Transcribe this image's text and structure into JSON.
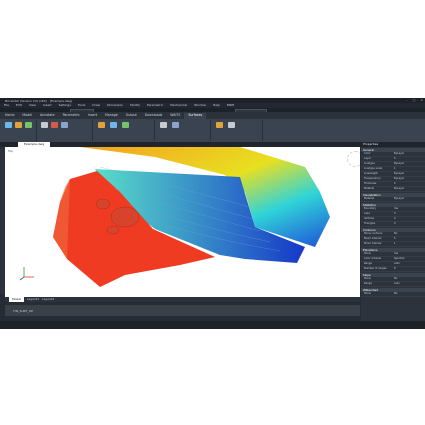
{
  "window": {
    "title": "BricsCAD (Version 24) (x64) - [Example.dwg]"
  },
  "menu": [
    "File",
    "Edit",
    "View",
    "Insert",
    "Settings",
    "Tools",
    "Draw",
    "Dimension",
    "Modify",
    "Parametric",
    "Mechanical",
    "Window",
    "Help",
    "MRM"
  ],
  "ribbon_tabs": [
    {
      "label": "Home",
      "active": false
    },
    {
      "label": "Model",
      "active": false
    },
    {
      "label": "Annotate",
      "active": false
    },
    {
      "label": "Parametric",
      "active": false
    },
    {
      "label": "Insert",
      "active": false
    },
    {
      "label": "Manage",
      "active": false
    },
    {
      "label": "Output",
      "active": false
    },
    {
      "label": "Downloads",
      "active": false
    },
    {
      "label": "WAITS",
      "active": false
    },
    {
      "label": "Surfaces",
      "active": true
    }
  ],
  "doc_tab": "Example.dwg",
  "viewport": {
    "label": "Top"
  },
  "layout_tabs": [
    "Model",
    "Layout1",
    "Layout2"
  ],
  "command_line": "TIN_SURF_OP",
  "colors": {
    "chrome": "#262c35",
    "ribbon": "#3a4350",
    "accent": "#e2a23b",
    "viewport_bg": "#ffffff"
  },
  "properties": {
    "title": "Properties",
    "sections": [
      {
        "name": "General",
        "rows": [
          [
            "Color",
            "ByLayer"
          ],
          [
            "Layer",
            "0"
          ],
          [
            "Linetype",
            "ByLayer"
          ],
          [
            "Linetype scale",
            "1"
          ],
          [
            "Lineweight",
            "ByLayer"
          ],
          [
            "Transparency",
            "ByLayer"
          ],
          [
            "Thickness",
            "0"
          ],
          [
            "Material",
            "ByLayer"
          ]
        ]
      },
      {
        "name": "Visualization",
        "rows": [
          [
            "Material",
            "ByLayer"
          ]
        ]
      },
      {
        "name": "Statistics",
        "rows": [
          [
            "Boundary",
            "Yes"
          ],
          [
            "Area",
            "0"
          ],
          [
            "Vertices",
            "0"
          ],
          [
            "Triangles",
            "0"
          ]
        ]
      },
      {
        "name": "Contours",
        "rows": [
          [
            "Show contours",
            "No"
          ],
          [
            "Major interval",
            "5"
          ],
          [
            "Minor interval",
            "1"
          ]
        ]
      },
      {
        "name": "Elevations",
        "rows": [
          [
            "Show",
            "Yes"
          ],
          [
            "Color scheme",
            "Spectral"
          ],
          [
            "Range",
            "Auto"
          ],
          [
            "Number of ranges",
            "8"
          ]
        ]
      },
      {
        "name": "Slope",
        "rows": [
          [
            "Show",
            "No"
          ],
          [
            "Range",
            "Auto"
          ]
        ]
      },
      {
        "name": "Watershed",
        "rows": [
          [
            "Show",
            "No"
          ]
        ]
      }
    ]
  }
}
